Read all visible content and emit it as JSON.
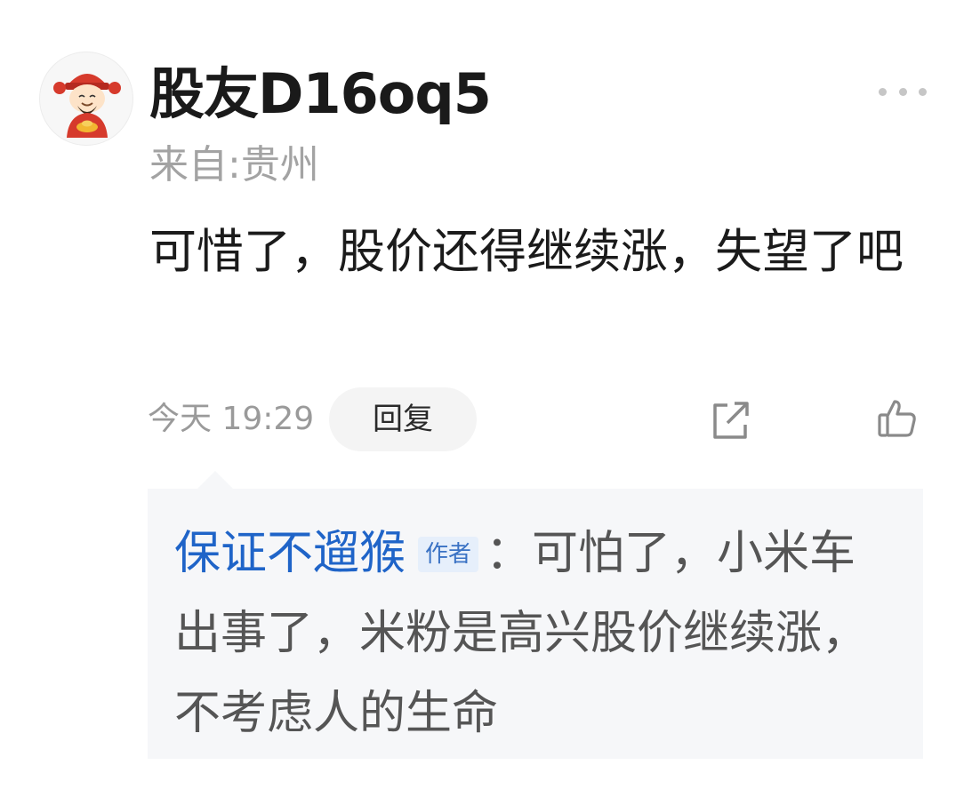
{
  "comment": {
    "username": "股友D16oq5",
    "location": "来自:贵州",
    "text": "可惜了，股价还得继续涨，失望了吧",
    "timestamp": "今天 19:29",
    "reply_label": "回复",
    "avatar_icon": "god-of-wealth-avatar",
    "share_icon": "share-icon",
    "like_icon": "thumbs-up-icon",
    "more_icon": "more-dots-icon"
  },
  "reply": {
    "author": "保证不遛猴",
    "badge": "作者",
    "separator": "：",
    "text": "可怕了，小米车出事了，米粉是高兴股价继续涨，不考虑人的生命"
  },
  "colors": {
    "author_link": "#1f64c8",
    "badge_bg": "#e6effb",
    "reply_bg": "#f6f7f9",
    "muted_text": "#a3a3a3"
  }
}
